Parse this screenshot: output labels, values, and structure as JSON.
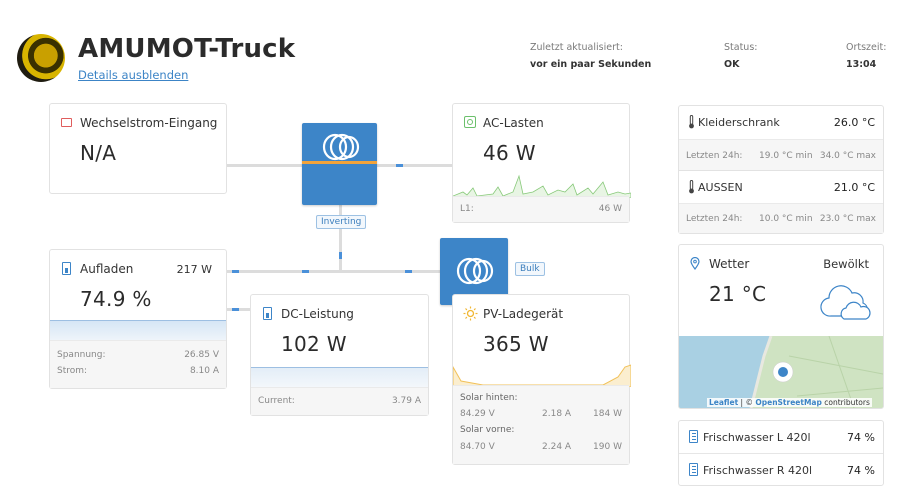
{
  "header": {
    "title": "AMUMOT-Truck",
    "details_link": "Details ausblenden",
    "updated_label": "Zuletzt aktualisiert:",
    "updated_value": "vor ein paar Sekunden",
    "status_label": "Status:",
    "status_value": "OK",
    "time_label": "Ortszeit:",
    "time_value": "13:04"
  },
  "ac_input": {
    "title": "Wechselstrom-Eingang",
    "value": "N/A",
    "icon": "ac-input-icon"
  },
  "inverter": {
    "tag": "Inverting",
    "icon": "victron-logo-icon"
  },
  "charger": {
    "tag": "Bulk",
    "icon": "victron-logo-icon"
  },
  "ac_loads": {
    "title": "AC-Lasten",
    "value": "46 W",
    "foot_label": "L1:",
    "foot_value": "46 W",
    "icon": "ac-loads-icon"
  },
  "battery": {
    "title": "Aufladen",
    "power": "217 W",
    "soc": "74.9 %",
    "rows": [
      {
        "label": "Spannung:",
        "value": "26.85 V"
      },
      {
        "label": "Strom:",
        "value": "8.10 A"
      }
    ],
    "icon": "battery-icon"
  },
  "dc_power": {
    "title": "DC-Leistung",
    "value": "102 W",
    "foot_label": "Current:",
    "foot_value": "3.79 A",
    "icon": "dc-power-icon"
  },
  "pv": {
    "title": "PV-Ladegerät",
    "value": "365 W",
    "groups": [
      {
        "name": "Solar hinten:",
        "v": "84.29 V",
        "a": "2.18 A",
        "w": "184 W"
      },
      {
        "name": "Solar vorne:",
        "v": "84.70 V",
        "a": "2.24 A",
        "w": "190 W"
      }
    ],
    "icon": "sun-icon"
  },
  "temps": [
    {
      "name": "Kleiderschrank",
      "value": "26.0 °C",
      "label24": "Letzten 24h:",
      "min": "19.0 °C min",
      "max": "34.0 °C max",
      "icon": "thermometer-icon"
    },
    {
      "name": "AUSSEN",
      "value": "21.0 °C",
      "label24": "Letzten 24h:",
      "min": "10.0 °C min",
      "max": "23.0 °C max",
      "icon": "thermometer-icon"
    }
  ],
  "weather": {
    "title": "Wetter",
    "condition": "Bewölkt",
    "temp": "21 °C",
    "map_attr_leaflet": "Leaflet",
    "map_attr_sep": " | © ",
    "map_attr_osm": "OpenStreetMap",
    "map_attr_rest": " contributors",
    "icons": {
      "pin": "location-pin-icon",
      "cloud": "cloud-icon"
    }
  },
  "tanks": [
    {
      "name": "Frischwasser L 420l",
      "value": "74 %",
      "icon": "tank-icon"
    },
    {
      "name": "Frischwasser R 420l",
      "value": "74 %",
      "icon": "tank-icon"
    }
  ],
  "colors": {
    "accent": "#3d85c8",
    "link": "#3c84c6",
    "ac_green": "#6cc06c",
    "battery_blue": "#3d85c8",
    "solar": "#f1b733"
  }
}
